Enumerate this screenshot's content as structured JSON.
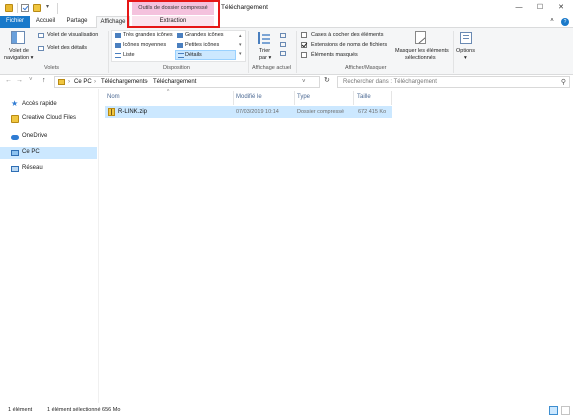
{
  "window": {
    "title": "Téléchargement",
    "minimize_glyph": "—",
    "maximize_glyph": "☐",
    "close_glyph": "✕"
  },
  "quick_access": {
    "dropdown_glyph": "▾"
  },
  "ribbon_context": {
    "tools_header": "Outils de dossier compressé"
  },
  "tabs": {
    "fichier": "Fichier",
    "accueil": "Accueil",
    "partage": "Partage",
    "affichage": "Affichage",
    "extraction": "Extraction"
  },
  "ribbon": {
    "volets": {
      "label": "Volets",
      "nav_pane": "Volet de",
      "nav_pane_2": "navigation ▾",
      "preview_pane": "Volet de visualisation",
      "details_pane": "Volet des détails"
    },
    "disposition": {
      "label": "Disposition",
      "items": [
        "Très grandes icônes",
        "Grandes icônes",
        "Icônes moyennes",
        "Petites icônes",
        "Liste",
        "Détails"
      ]
    },
    "affichage_actuel": {
      "label": "Affichage actuel",
      "sort_by": "Trier",
      "sort_by_2": "par ▾"
    },
    "afficher_masquer": {
      "label": "Afficher/Masquer",
      "checkboxes": [
        {
          "label": "Cases à cocher des éléments",
          "checked": false
        },
        {
          "label": "Extensions de noms de fichiers",
          "checked": true
        },
        {
          "label": "Éléments masqués",
          "checked": false
        }
      ],
      "hide_selected": "Masquer les éléments",
      "hide_selected_2": "sélectionnés"
    },
    "options": {
      "label": "Options",
      "arrow": "▾"
    }
  },
  "address": {
    "back": "←",
    "forward": "→",
    "recent": "˅",
    "up": "↑",
    "path": [
      "Ce PC",
      "Téléchargements",
      "Téléchargement"
    ],
    "chevron": "›",
    "dropdown": "˅",
    "refresh": "↻",
    "search_placeholder": "Rechercher dans : Téléchargement",
    "search_glyph": "⚲"
  },
  "sidebar": {
    "items": [
      {
        "label": "Accès rapide",
        "icon": "star-icon"
      },
      {
        "label": "Creative Cloud Files",
        "icon": "creative-cloud-icon"
      },
      {
        "label": "OneDrive",
        "icon": "onedrive-icon"
      },
      {
        "label": "Ce PC",
        "icon": "pc-icon",
        "selected": true
      },
      {
        "label": "Réseau",
        "icon": "network-icon"
      }
    ]
  },
  "file_list": {
    "columns": [
      "Nom",
      "Modifié le",
      "Type",
      "Taille"
    ],
    "sort_glyph": "^",
    "rows": [
      {
        "name": "R-LINK.zip",
        "modified": "07/03/2019 10:14",
        "type": "Dossier compressé",
        "size": "672 415 Ko"
      }
    ]
  },
  "status": {
    "count": "1 élément",
    "selection": "1 élément sélectionné  656 Mo"
  },
  "colors": {
    "accent": "#1979ca",
    "selection": "#cce8ff",
    "tools_header": "#f4c2dd",
    "highlight_frame": "#e61616"
  }
}
